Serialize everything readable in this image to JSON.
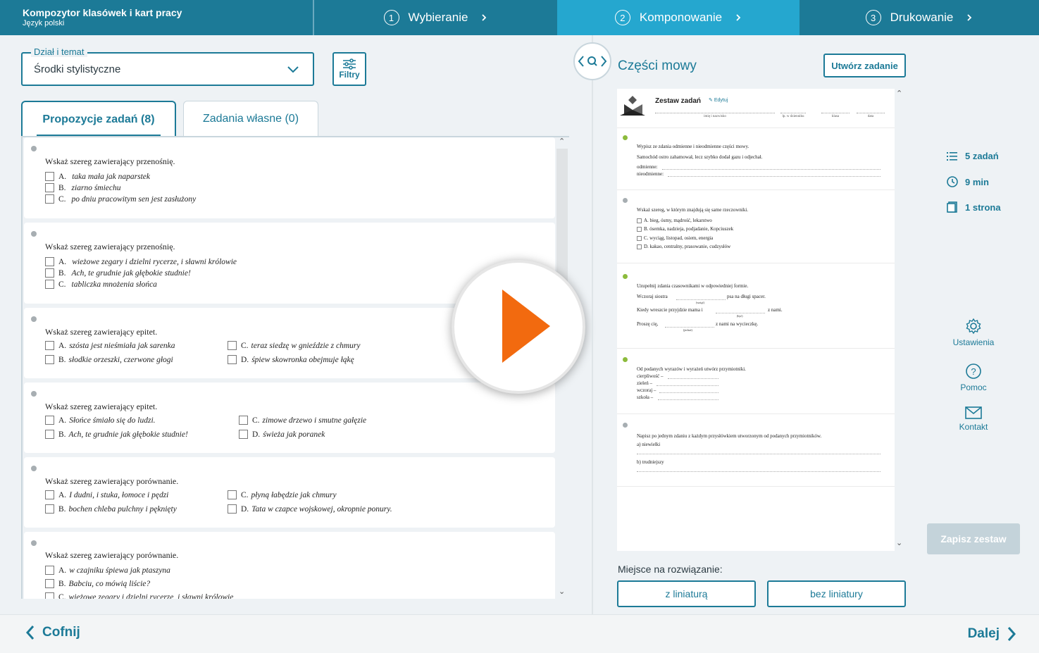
{
  "app": {
    "title": "Kompozytor klasówek i kart pracy",
    "subtitle": "Język polski"
  },
  "steps": [
    {
      "num": "1",
      "label": "Wybieranie"
    },
    {
      "num": "2",
      "label": "Komponowanie"
    },
    {
      "num": "3",
      "label": "Drukowanie"
    }
  ],
  "topic": {
    "label": "Dział i temat",
    "value": "Środki stylistyczne"
  },
  "filters_label": "Filtry",
  "tabs": {
    "proposals": "Propozycje zadań (8)",
    "own": "Zadania własne (0)"
  },
  "tasks": [
    {
      "question": "Wskaż szereg zawierający przenośnię.",
      "options": [
        {
          "letter": "A.",
          "text": "taka mała jak naparstek"
        },
        {
          "letter": "B.",
          "text": "ziarno śmiechu"
        },
        {
          "letter": "C.",
          "text": "po dniu pracowitym sen jest zasłużony"
        }
      ]
    },
    {
      "question": "Wskaż szereg zawierający przenośnię.",
      "options": [
        {
          "letter": "A.",
          "text": "wieżowe zegary i dzielni rycerze, i sławni królowie"
        },
        {
          "letter": "B.",
          "text": "Ach, te grudnie jak głębokie studnie!"
        },
        {
          "letter": "C.",
          "text": "tabliczka mnożenia słońca"
        }
      ]
    },
    {
      "question": "Wskaż szereg zawierający epitet.",
      "options": [
        {
          "letter": "A.",
          "text": "szósta jest nieśmiała jak sarenka"
        },
        {
          "letter": "B.",
          "text": "słodkie orzeszki, czerwone głogi"
        },
        {
          "letter": "C.",
          "text": "teraz siedzę w gnieździe z chmury"
        },
        {
          "letter": "D.",
          "text": "śpiew skowronka obejmuje łąkę"
        }
      ]
    },
    {
      "question": "Wskaż szereg zawierający epitet.",
      "options": [
        {
          "letter": "A.",
          "text": "Słońce śmiało się do ludzi."
        },
        {
          "letter": "B.",
          "text": "Ach, te grudnie jak głębokie studnie!"
        },
        {
          "letter": "C.",
          "text": "zimowe drzewo i smutne gałęzie"
        },
        {
          "letter": "D.",
          "text": "świeża jak poranek"
        }
      ]
    },
    {
      "question": "Wskaż szereg zawierający porównanie.",
      "options": [
        {
          "letter": "A.",
          "text": "I dudni, i stuka, łomoce i pędzi"
        },
        {
          "letter": "B.",
          "text": "bochen chleba pulchny i pęknięty"
        },
        {
          "letter": "C.",
          "text": "płyną łabędzie jak chmury"
        },
        {
          "letter": "D.",
          "text": "Tata w czapce wojskowej, okropnie ponury."
        }
      ]
    },
    {
      "question": "Wskaż szereg zawierający porównanie.",
      "options": [
        {
          "letter": "A.",
          "text": "w czajniku śpiewa jak ptaszyna"
        },
        {
          "letter": "B.",
          "text": "Babciu, co mówią liście?"
        },
        {
          "letter": "C.",
          "text": "wieżowe zegary i dzielni rycerze, i sławni królowie"
        }
      ]
    }
  ],
  "preview": {
    "section_title": "Części mowy",
    "create_label": "Utwórz zadanie",
    "set_title": "Zestaw zadań",
    "edit_label": "Edytuj",
    "fields": [
      "imię i nazwisko",
      "lp. w dzienniku",
      "klasa",
      "data"
    ],
    "s1": {
      "q": "Wypisz ze zdania odmienne i nieodmienne części mowy.",
      "sentence": "Samochód ostro zahamował, lecz szybko dodał gazu i odjechał.",
      "l1": "odmienne:",
      "l2": "nieodmienne:"
    },
    "s2": {
      "q": "Wskaż szereg, w którym znajdują się same rzeczowniki.",
      "options": [
        "A. bieg, ósmy, mądrość, lekarstwo",
        "B. ósemka, nadzieja, podjadanie, Kopciuszek",
        "C. wyciąg, listopad, osiem, energia",
        "D. kakao, centralny, prasowanie, cudzysłów"
      ]
    },
    "s3": {
      "q": "Uzupełnij zdania czasownikami w odpowiedniej formie.",
      "a1": "Wczoraj siostra",
      "a2": "psa na długi spacer.",
      "h1": "(wziąć)",
      "b1": "Kiedy wreszcie przyjdzie mama i",
      "b2": "z nami.",
      "h2": "(być)",
      "c1": "Proszę cię,",
      "c2": "z nami na wycieczkę.",
      "h3": "(jechać)"
    },
    "s4": {
      "q": "Od podanych wyrazów i wyrażeń utwórz przymiotniki.",
      "items": [
        "cierpliwość –",
        "zieleń –",
        "wczoraj –",
        "szkoła –"
      ]
    },
    "s5": {
      "q": "Napisz po jednym zdaniu z każdym przysłówkiem utworzonym od podanych przymiotników.",
      "a": "a)  niewielki",
      "b": "b)  trudniejszy"
    }
  },
  "space": {
    "label": "Miejsce na rozwiązanie:",
    "with_lines": "z liniaturą",
    "without_lines": "bez liniatury"
  },
  "stats": {
    "tasks": "5 zadań",
    "time": "9 min",
    "pages": "1 strona"
  },
  "side": {
    "settings": "Ustawienia",
    "help": "Pomoc",
    "contact": "Kontakt"
  },
  "save_label": "Zapisz zestaw",
  "nav": {
    "back": "Cofnij",
    "next": "Dalej"
  },
  "colors": {
    "primary": "#1c7a97",
    "active_step": "#25a7cf",
    "play": "#f26a0f",
    "dot_green": "#8cbb3c",
    "dot_grey": "#a7aeb2"
  }
}
